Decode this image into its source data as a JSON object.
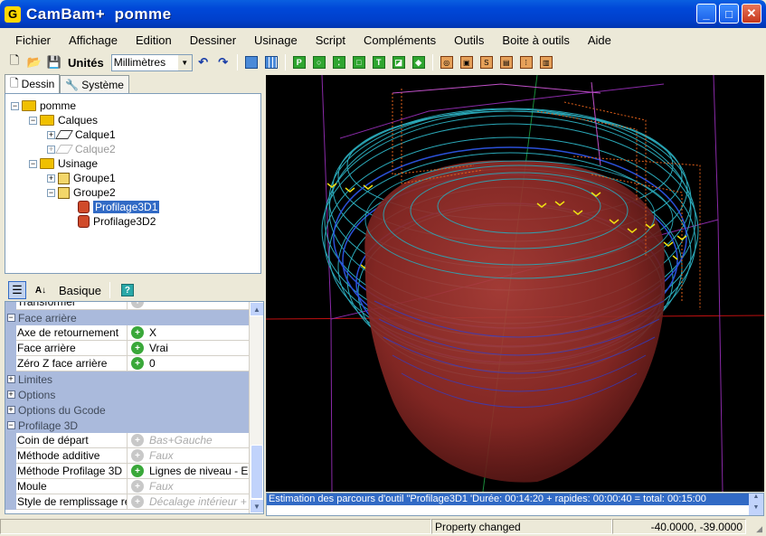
{
  "window": {
    "app_name": "CamBam+",
    "doc_name": "pomme",
    "title": "CamBam+  pomme"
  },
  "menu": [
    "Fichier",
    "Affichage",
    "Edition",
    "Dessiner",
    "Usinage",
    "Script",
    "Compléments",
    "Outils",
    "Boite à outils",
    "Aide"
  ],
  "toolbar": {
    "units_label": "Unités",
    "units_value": "Millimètres"
  },
  "tabs": {
    "dessin": "Dessin",
    "systeme": "Système"
  },
  "tree": {
    "root": "pomme",
    "calques": "Calques",
    "calque1": "Calque1",
    "calque2": "Calque2",
    "usinage": "Usinage",
    "groupe1": "Groupe1",
    "groupe2": "Groupe2",
    "profilage1": "Profilage3D1",
    "profilage2": "Profilage3D2"
  },
  "props_toolbar": {
    "basique": "Basique"
  },
  "properties": [
    {
      "type": "prop",
      "name": "Transformer",
      "icon": "n",
      "value": ""
    },
    {
      "type": "cat",
      "name": "Face arrière",
      "sign": "−"
    },
    {
      "type": "prop",
      "name": "Axe de retournement",
      "icon": "g",
      "value": "X"
    },
    {
      "type": "prop",
      "name": "Face arrière",
      "icon": "g",
      "value": "Vrai"
    },
    {
      "type": "prop",
      "name": "Zéro Z face arrière",
      "icon": "g",
      "value": "0"
    },
    {
      "type": "cat",
      "name": "Limites",
      "sign": "+"
    },
    {
      "type": "cat",
      "name": "Options",
      "sign": "+"
    },
    {
      "type": "cat",
      "name": "Options du Gcode",
      "sign": "+"
    },
    {
      "type": "cat",
      "name": "Profilage 3D",
      "sign": "−"
    },
    {
      "type": "prop",
      "name": "Coin de départ",
      "icon": "n",
      "value": "Bas+Gauche",
      "italic": true
    },
    {
      "type": "prop",
      "name": "Méthode additive",
      "icon": "n",
      "value": "Faux",
      "italic": true
    },
    {
      "type": "prop",
      "name": "Méthode Profilage 3D",
      "icon": "g",
      "value": "Lignes de niveau - Ebauche"
    },
    {
      "type": "prop",
      "name": "Moule",
      "icon": "n",
      "value": "Faux",
      "italic": true
    },
    {
      "type": "prop",
      "name": "Style de remplissage régions",
      "icon": "n",
      "value": "Décalage intérieur + extérieur",
      "italic": true
    }
  ],
  "status": {
    "log_line": "Estimation des parcours d'outil \"Profilage3D1 'Durée: 00:14:20 + rapides: 00:00:40 = total: 00:15:00",
    "message": "Property changed",
    "coords": "-40.0000, -39.0000"
  }
}
